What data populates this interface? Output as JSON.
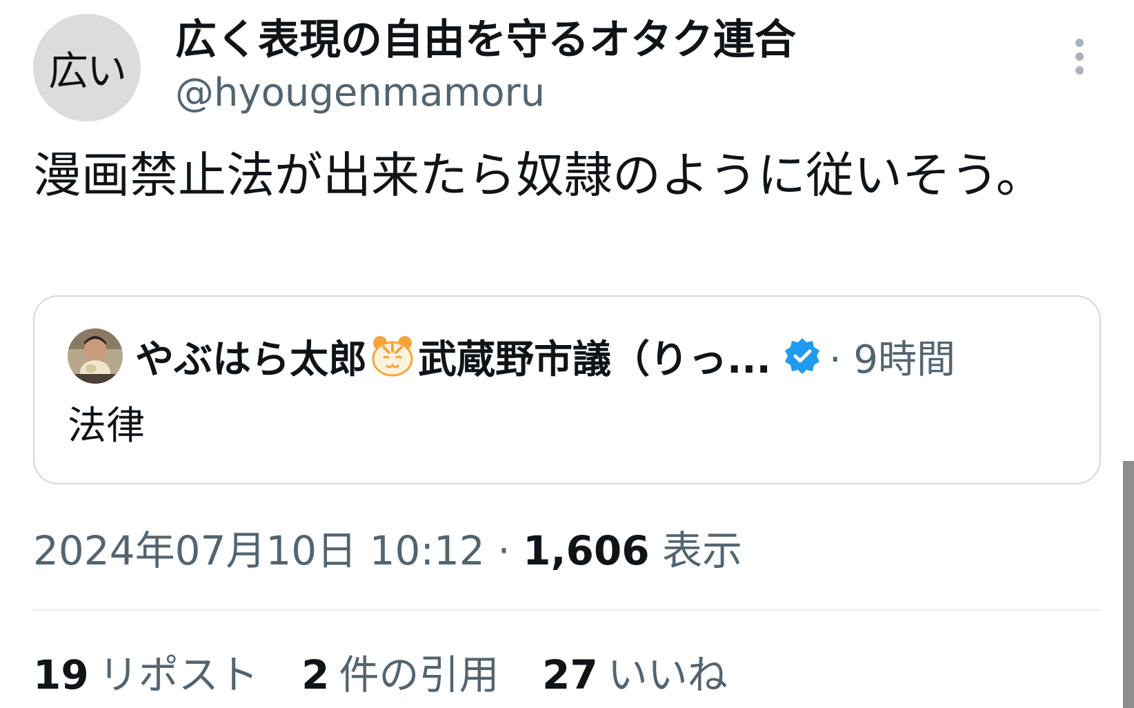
{
  "author": {
    "avatar_text": "広い",
    "display_name": "広く表現の自由を守るオタク連合",
    "handle": "@hyougenmamoru"
  },
  "tweet": {
    "text": "漫画禁止法が出来たら奴隷のように従いそう。",
    "timestamp": "2024年07月10日 10:12",
    "separator": "·",
    "views_count": "1,606",
    "views_label": "表示"
  },
  "quote": {
    "name_part1": "やぶはら太郎",
    "name_emoji": "tiger-face-icon",
    "name_part2": "武蔵野市議（りっ...",
    "verified": "verified-badge-icon",
    "time": "· 9時間",
    "body": "法律"
  },
  "stats": {
    "reposts_count": "19",
    "reposts_label": "リポスト",
    "quotes_count": "2",
    "quotes_label": "件の引用",
    "likes_count": "27",
    "likes_label": "いいね"
  },
  "colors": {
    "text_primary": "#0f1419",
    "text_secondary": "#536471",
    "border": "#cfd9de",
    "verified": "#1d9bf0",
    "tiger": "#f5a53a"
  }
}
